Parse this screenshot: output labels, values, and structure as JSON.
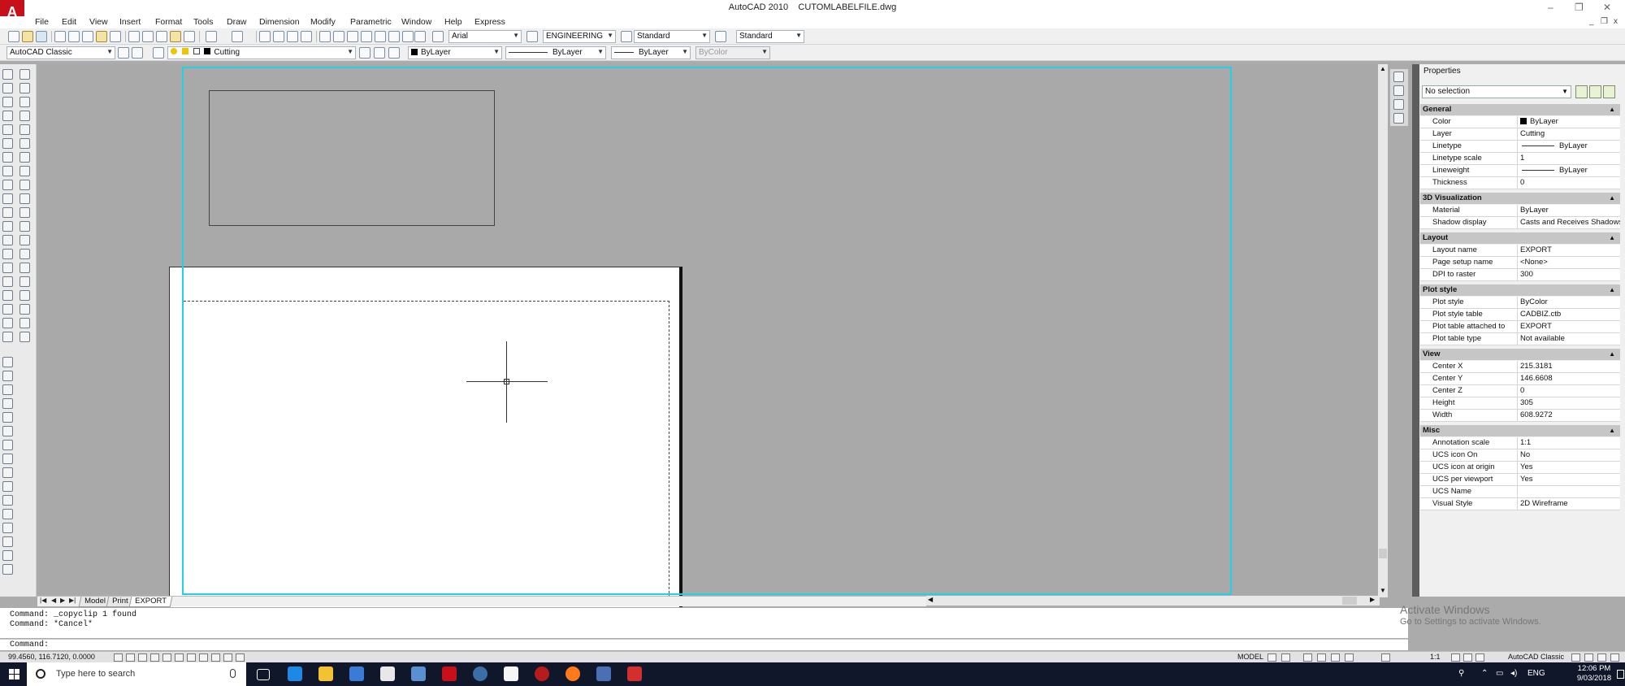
{
  "window": {
    "app_name": "AutoCAD 2010",
    "file_name": "CUTOMLABELFILE.dwg",
    "logo_letter": "A",
    "controls": [
      "–",
      "❐",
      "✕"
    ]
  },
  "menu": {
    "items": [
      "File",
      "Edit",
      "View",
      "Insert",
      "Format",
      "Tools",
      "Draw",
      "Dimension",
      "Modify",
      "Parametric",
      "Window",
      "Help",
      "Express"
    ],
    "doc_controls": [
      "_",
      "❐",
      "x"
    ]
  },
  "toolbar": {
    "text_font": "Arial",
    "dim_style": "ENGINEERING",
    "table_style": "Standard",
    "multileader_style": "Standard"
  },
  "toolbar2": {
    "workspace": "AutoCAD Classic",
    "layer": "Cutting",
    "color": "ByLayer",
    "linetype": "ByLayer",
    "lineweight": "ByLayer",
    "plot_style": "ByColor"
  },
  "layout_tabs": {
    "nav": [
      "|◀",
      "◀",
      "▶",
      "▶|"
    ],
    "tabs": [
      "Model",
      "Print",
      "EXPORT"
    ]
  },
  "properties": {
    "title": "Properties",
    "selection": "No selection",
    "categories": [
      {
        "name": "General",
        "rows": [
          {
            "key": "Color",
            "value": "ByLayer",
            "swatch": true
          },
          {
            "key": "Layer",
            "value": "Cutting"
          },
          {
            "key": "Linetype",
            "value": "ByLayer",
            "line": true
          },
          {
            "key": "Linetype scale",
            "value": "1"
          },
          {
            "key": "Lineweight",
            "value": "ByLayer",
            "line": true
          },
          {
            "key": "Thickness",
            "value": "0"
          }
        ]
      },
      {
        "name": "3D Visualization",
        "rows": [
          {
            "key": "Material",
            "value": "ByLayer"
          },
          {
            "key": "Shadow display",
            "value": "Casts and Receives Shadows"
          }
        ]
      },
      {
        "name": "Layout",
        "rows": [
          {
            "key": "Layout name",
            "value": "EXPORT"
          },
          {
            "key": "Page setup name",
            "value": "<None>"
          },
          {
            "key": "DPI to raster",
            "value": "300"
          }
        ]
      },
      {
        "name": "Plot style",
        "rows": [
          {
            "key": "Plot style",
            "value": "ByColor"
          },
          {
            "key": "Plot style table",
            "value": "CADBIZ.ctb"
          },
          {
            "key": "Plot table attached to",
            "value": "EXPORT"
          },
          {
            "key": "Plot table type",
            "value": "Not available"
          }
        ]
      },
      {
        "name": "View",
        "rows": [
          {
            "key": "Center X",
            "value": "215.3181"
          },
          {
            "key": "Center Y",
            "value": "146.6608"
          },
          {
            "key": "Center Z",
            "value": "0"
          },
          {
            "key": "Height",
            "value": "305"
          },
          {
            "key": "Width",
            "value": "608.9272"
          }
        ]
      },
      {
        "name": "Misc",
        "rows": [
          {
            "key": "Annotation scale",
            "value": "1:1"
          },
          {
            "key": "UCS icon On",
            "value": "No"
          },
          {
            "key": "UCS icon at origin",
            "value": "Yes"
          },
          {
            "key": "UCS per viewport",
            "value": "Yes"
          },
          {
            "key": "UCS Name",
            "value": ""
          },
          {
            "key": "Visual Style",
            "value": "2D Wireframe"
          }
        ]
      }
    ]
  },
  "command": {
    "history": [
      "Command: _copyclip 1 found",
      "Command: *Cancel*"
    ],
    "prompt": "Command:"
  },
  "status": {
    "coords": "99.4560, 116.7120, 0.0000",
    "space": "MODEL",
    "annotation_scale": "1:1",
    "workspace": "AutoCAD Classic"
  },
  "activation": {
    "line1": "Activate Windows",
    "line2": "Go to Settings to activate Windows."
  },
  "taskbar": {
    "search_placeholder": "Type here to search",
    "language": "ENG",
    "time": "12:06 PM",
    "date": "9/03/2018"
  }
}
